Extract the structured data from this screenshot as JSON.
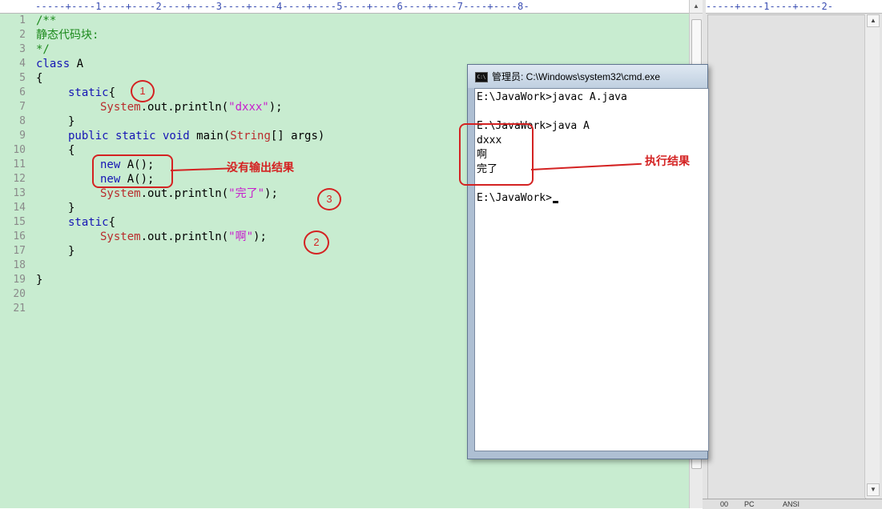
{
  "editor": {
    "ruler_text": "-----+----1----+----2----+----3----+----4----+----5----+----6----+----7----+----8-",
    "line_numbers": [
      "1",
      "2",
      "3",
      "4",
      "5",
      "6",
      "7",
      "8",
      "9",
      "10",
      "11",
      "12",
      "13",
      "14",
      "15",
      "16",
      "17",
      "18",
      "19",
      "20",
      "21"
    ],
    "code": {
      "l1": "/**",
      "l2": "静态代码块:",
      "l3": "*/",
      "l4_kw": "class",
      "l4_name": " A",
      "l5": "{",
      "l6_kw": "static",
      "l6_brace": "{",
      "l7_cls": "System",
      "l7_mid": ".out.println(",
      "l7_str": "\"dxxx\"",
      "l7_end": ");",
      "l8": "}",
      "l9_kw": "public static void",
      "l9_mid": " main(",
      "l9_cls": "String",
      "l9_end": "[] args)",
      "l10": "{",
      "l11_kw": "new",
      "l11_rest": " A();",
      "l12_kw": "new",
      "l12_rest": " A();",
      "l13_cls": "System",
      "l13_mid": ".out.println(",
      "l13_str": "\"完了\"",
      "l13_end": ");",
      "l14": "}",
      "l15_kw": "static",
      "l15_brace": "{",
      "l16_cls": "System",
      "l16_mid": ".out.println(",
      "l16_str": "\"啊\"",
      "l16_end": ");",
      "l17": "}",
      "l19": "}"
    }
  },
  "right_panel": {
    "ruler_text": "-----+----1----+----2-",
    "status": {
      "s1": "00",
      "s2": "PC",
      "s3": "ANSI"
    }
  },
  "cmd": {
    "title": "管理员: C:\\Windows\\system32\\cmd.exe",
    "icon_text": "C:\\",
    "lines": {
      "c1": "E:\\JavaWork>javac A.java",
      "c2": "E:\\JavaWork>java A",
      "c3": "dxxx",
      "c4": "啊",
      "c5": "完了",
      "c6": "E:\\JavaWork>"
    }
  },
  "annotations": {
    "circle1": "1",
    "circle2": "2",
    "circle3": "3",
    "note_no_output": "没有输出结果",
    "note_result": "执行结果"
  },
  "colors": {
    "editor_bg": "#c8ecd0",
    "keyword": "#1515b5",
    "comment": "#1c8a1c",
    "class": "#b92c2c",
    "string": "#c71ccd",
    "annotation": "#d42222"
  }
}
